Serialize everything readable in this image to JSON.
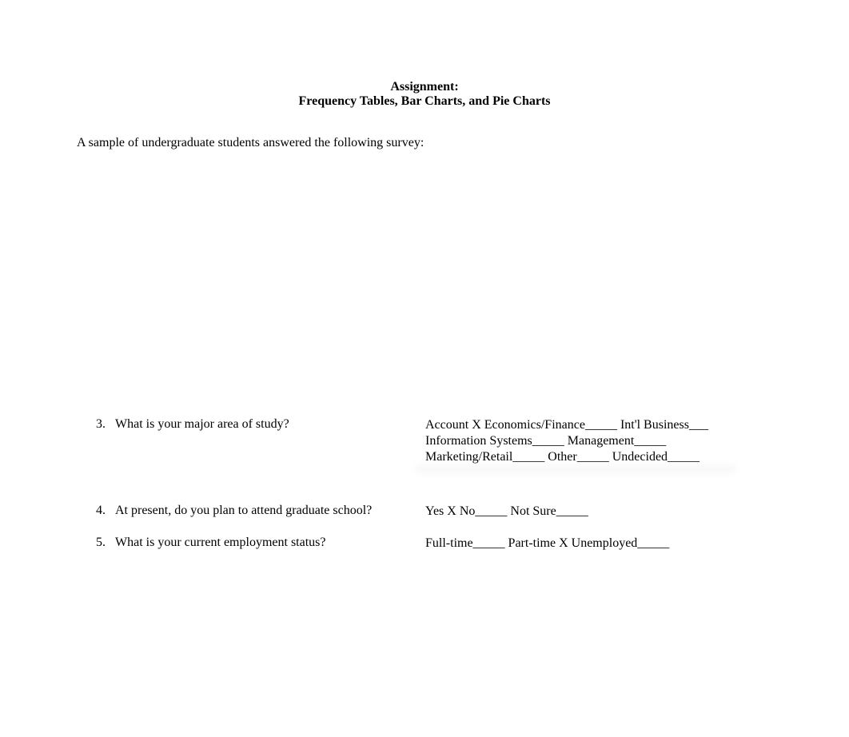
{
  "header": {
    "line1": "Assignment:",
    "line2": "Frequency Tables, Bar Charts, and Pie Charts"
  },
  "intro": "A sample of undergraduate students answered the following survey:",
  "questions": {
    "q3": {
      "number": "3.",
      "text": "What is your major area of study?",
      "answer": "Account X Economics/Finance_____ Int'l Business___ Information Systems_____ Management_____ Marketing/Retail_____ Other_____ Undecided_____"
    },
    "q4": {
      "number": "4.",
      "text": "At present, do you plan to attend graduate school?",
      "answer": "Yes X No_____ Not Sure_____"
    },
    "q5": {
      "number": "5.",
      "text": "What is your current employment status?",
      "answer": "Full-time_____ Part-time X Unemployed_____"
    }
  }
}
